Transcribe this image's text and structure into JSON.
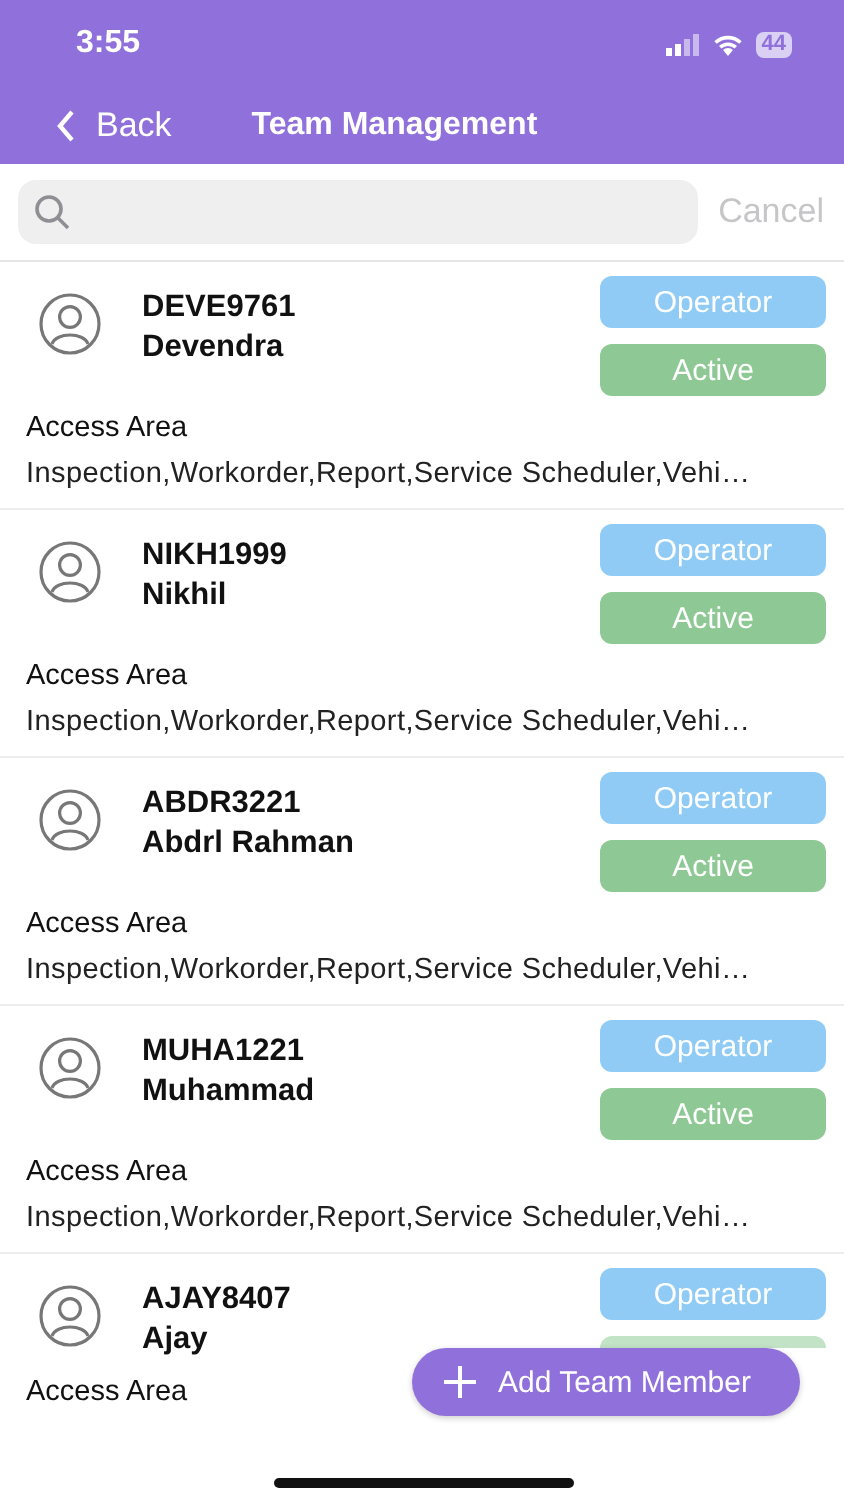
{
  "status_bar": {
    "time": "3:55",
    "battery": "44"
  },
  "header": {
    "back": "Back",
    "title": "Team Management"
  },
  "search": {
    "cancel": "Cancel"
  },
  "members": [
    {
      "code": "DEVE9761",
      "name": "Devendra",
      "role": "Operator",
      "status": {
        "label": "Active"
      },
      "access_label": "Access Area",
      "access_areas": "Inspection,Workorder,Report,Service Scheduler,Vehi…"
    },
    {
      "code": "NIKH1999",
      "name": "Nikhil",
      "role": "Operator",
      "status": {
        "label": "Active"
      },
      "access_label": "Access Area",
      "access_areas": "Inspection,Workorder,Report,Service Scheduler,Vehi…"
    },
    {
      "code": "ABDR3221",
      "name": "Abdrl Rahman",
      "role": "Operator",
      "status": {
        "label": "Active"
      },
      "access_label": "Access Area",
      "access_areas": "Inspection,Workorder,Report,Service Scheduler,Vehi…"
    },
    {
      "code": "MUHA1221",
      "name": "Muhammad",
      "role": "Operator",
      "status": {
        "label": "Active"
      },
      "access_label": "Access Area",
      "access_areas": "Inspection,Workorder,Report,Service Scheduler,Vehi…"
    },
    {
      "code": "AJAY8407",
      "name": "Ajay",
      "role": "Operator",
      "status": {
        "covered": true
      },
      "access_label": "Access Area"
    }
  ],
  "fab": {
    "label": "Add Team Member"
  }
}
